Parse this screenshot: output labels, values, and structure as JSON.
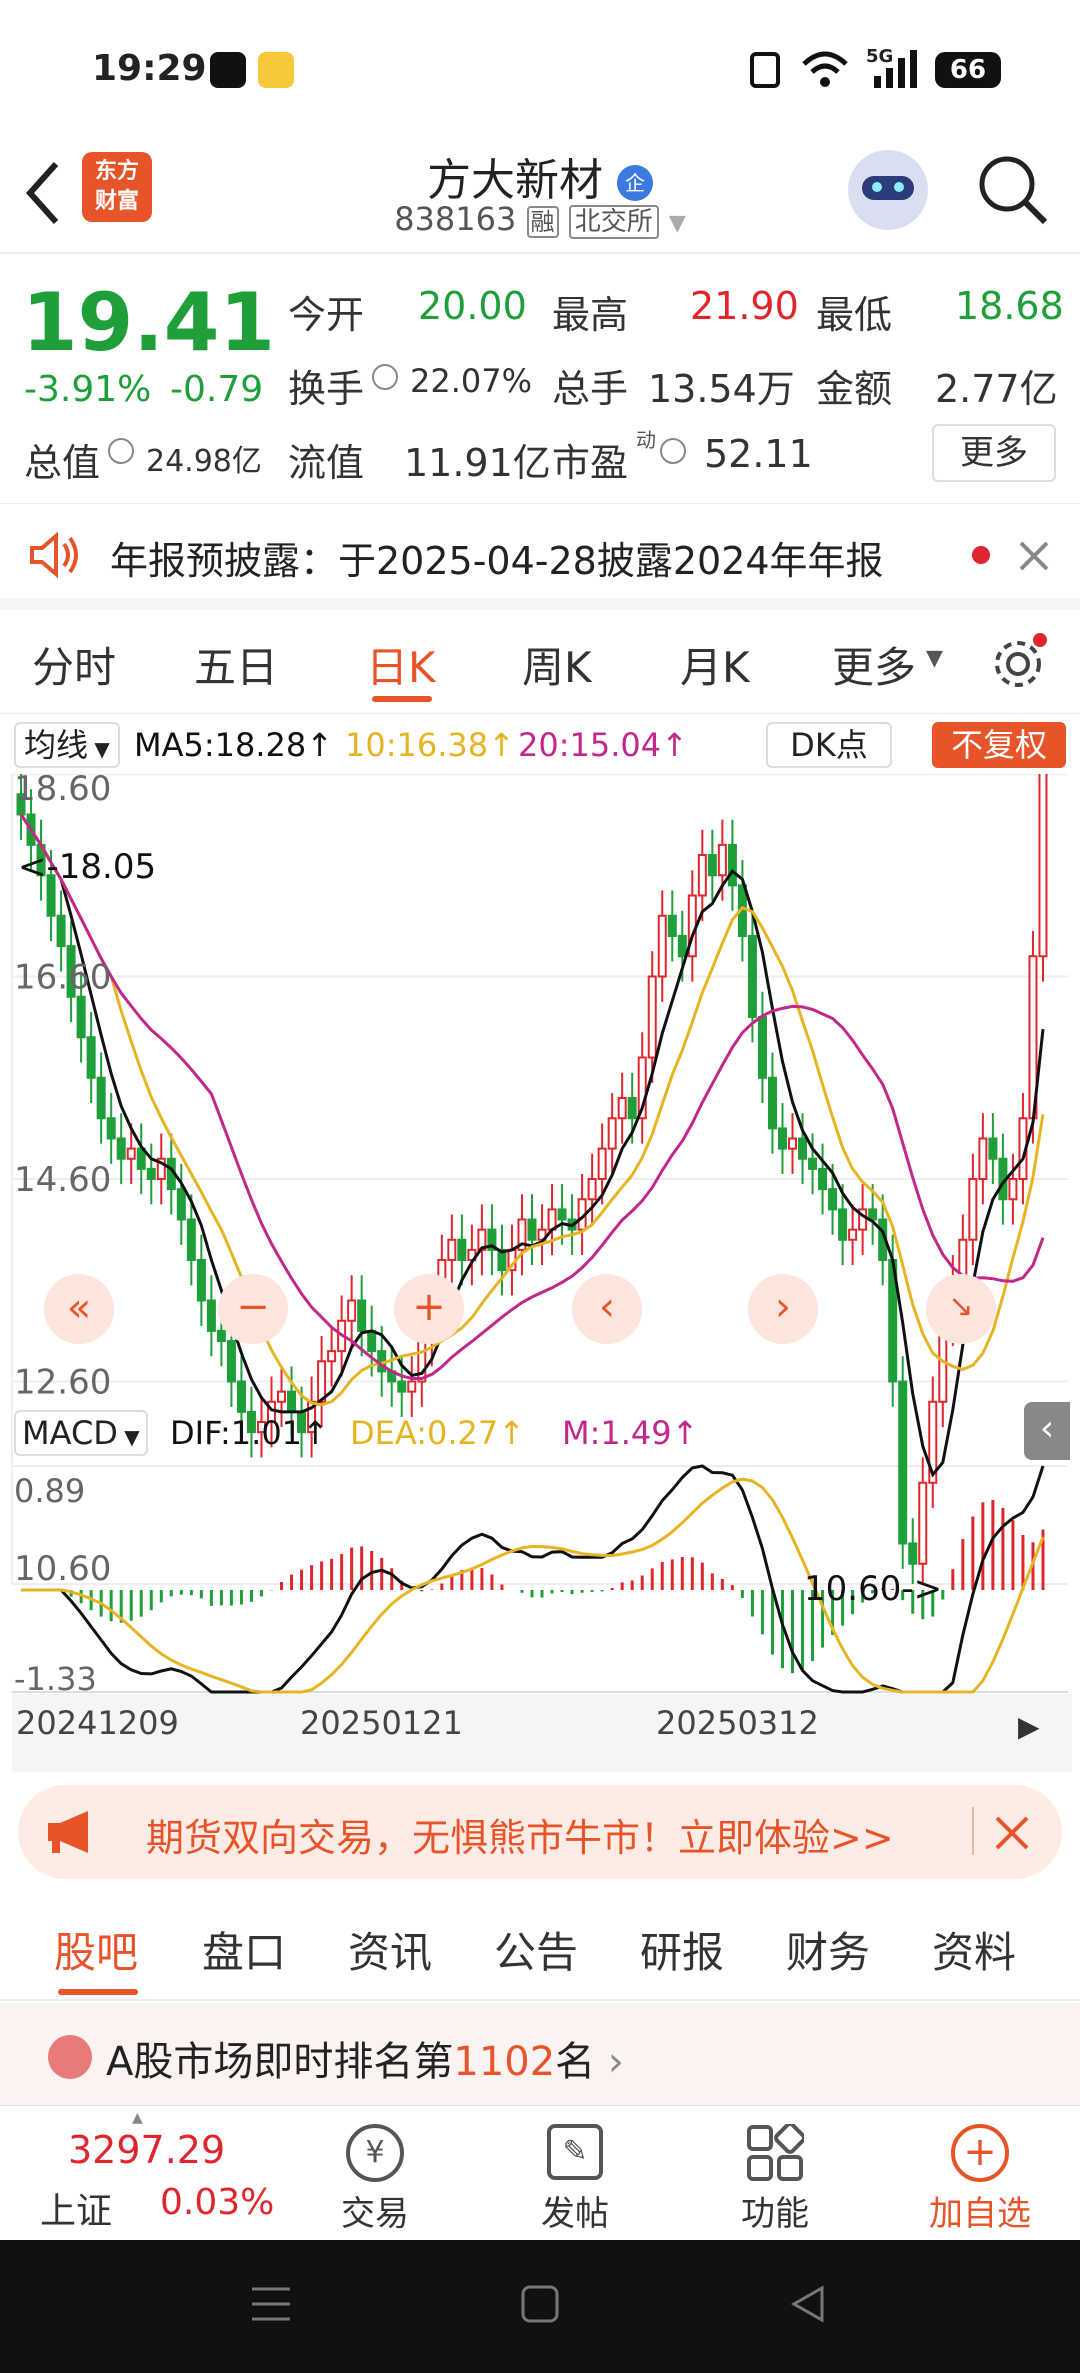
{
  "status_bar": {
    "time": "19:29",
    "network": "5G",
    "battery": "66"
  },
  "header": {
    "stock_name": "方大新材",
    "badge": "企",
    "code": "838163",
    "tag_margin": "融",
    "exchange": "北交所",
    "logo_line1": "东方",
    "logo_line2": "财富"
  },
  "quote": {
    "price": "19.41",
    "change_pct": "-3.91%",
    "change": "-0.79",
    "open_label": "今开",
    "open": "20.00",
    "high_label": "最高",
    "high": "21.90",
    "low_label": "最低",
    "low": "18.68",
    "turnover_label": "换手",
    "turnover": "22.07%",
    "volume_label": "总手",
    "volume": "13.54万",
    "amount_label": "金额",
    "amount": "2.77亿",
    "mcap_label": "总值",
    "mcap": "24.98亿",
    "float_label": "流值",
    "float": "11.91亿",
    "pe_label": "市盈",
    "pe_sup": "动",
    "pe": "52.11",
    "more_label": "更多"
  },
  "notice": {
    "text": "年报预披露：于2025-04-28披露2024年年报"
  },
  "kline_tabs": [
    "分时",
    "五日",
    "日K",
    "周K",
    "月K",
    "更多"
  ],
  "kline_active": "日K",
  "chart_header": {
    "ma_select": "均线",
    "ma5": "MA5:18.28↑",
    "ma10": "10:16.38↑",
    "ma20": "20:15.04↑",
    "dk": "DK点",
    "fq": "不复权"
  },
  "chart_data": {
    "type": "candlestick",
    "y_ticks": [
      "18.60",
      "16.60",
      "14.60",
      "12.60",
      "10.60"
    ],
    "ylim": [
      10.6,
      18.6
    ],
    "annotations": [
      "<-18.05",
      "10.60->"
    ],
    "macd": {
      "label": "MACD",
      "dif": "DIF:1.01↑",
      "dea": "DEA:0.27↑",
      "m": "M:1.49↑",
      "y_ticks": [
        "0.89",
        "-1.33"
      ]
    },
    "x_ticks": [
      "20241209",
      "20250121",
      "20250312"
    ],
    "colors": {
      "up": "#e0262c",
      "down": "#1f9f3a",
      "ma5": "#111111",
      "ma10": "#e6b422",
      "ma20": "#c0288a"
    }
  },
  "ad": {
    "text": "期货双向交易，无惧熊市牛市！立即体验>>"
  },
  "bottom_tabs": [
    "股吧",
    "盘口",
    "资讯",
    "公告",
    "研报",
    "财务",
    "资料"
  ],
  "bottom_active": "股吧",
  "rank": {
    "prefix": "A股市场即时排名第",
    "num": "1102",
    "suffix": "名"
  },
  "bottom_bar": {
    "index_value": "3297.29",
    "index_name": "上证",
    "index_change": "0.03%",
    "trade": "交易",
    "post": "发帖",
    "func": "功能",
    "add": "加自选"
  }
}
